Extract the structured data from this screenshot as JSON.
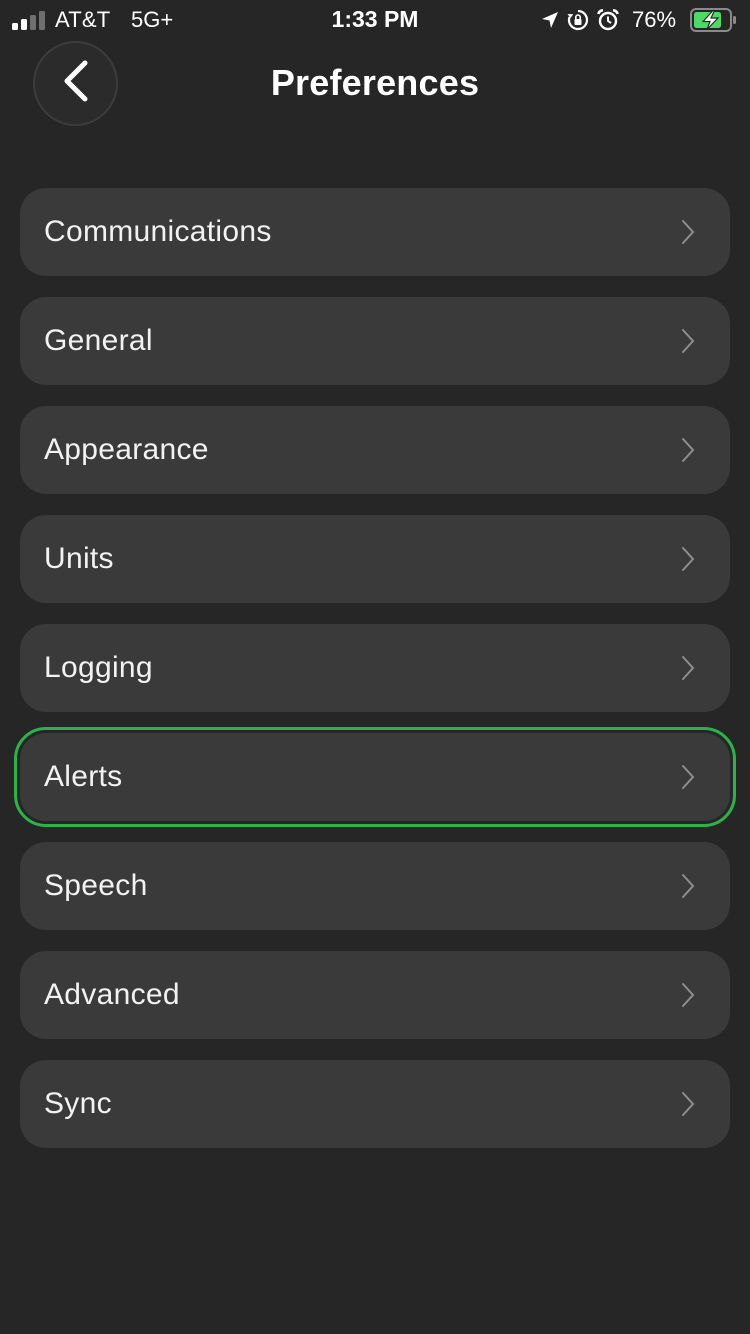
{
  "status_bar": {
    "carrier": "AT&T",
    "network": "5G+",
    "time": "1:33 PM",
    "battery_percent": "76%",
    "icons": [
      "location-arrow-icon",
      "orientation-lock-icon",
      "alarm-icon",
      "battery-charging-icon"
    ]
  },
  "header": {
    "title": "Preferences",
    "back_icon": "chevron-left-icon"
  },
  "menu": {
    "items": [
      {
        "label": "Communications"
      },
      {
        "label": "General"
      },
      {
        "label": "Appearance"
      },
      {
        "label": "Units"
      },
      {
        "label": "Logging"
      },
      {
        "label": "Alerts"
      },
      {
        "label": "Speech"
      },
      {
        "label": "Advanced"
      },
      {
        "label": "Sync"
      }
    ],
    "selected_label": "Alerts",
    "item_icon": "chevron-right-icon"
  },
  "colors": {
    "background": "#262626",
    "item_background": "#3a3a3a",
    "selection_outline": "#2bb34a",
    "battery_fill": "#4cd964",
    "chevron": "#8e8e8e"
  }
}
